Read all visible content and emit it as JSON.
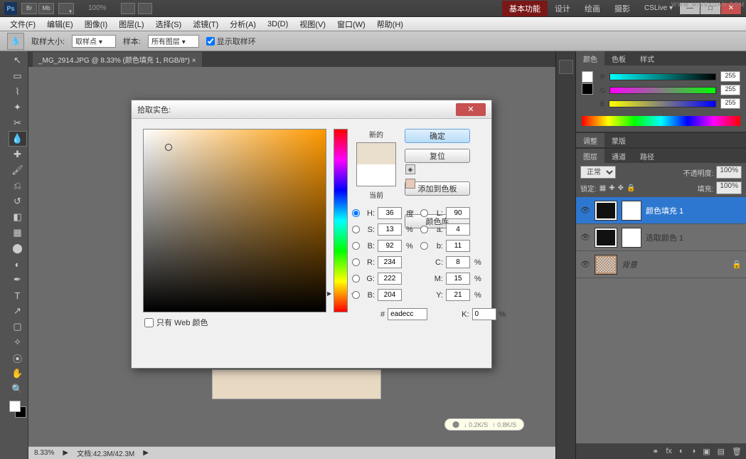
{
  "app": {
    "ps": "Ps",
    "br": "Br",
    "mb": "Mb",
    "zoom_pct": "100%"
  },
  "workspace": {
    "active": "基本功能",
    "tabs": [
      "基本功能",
      "设计",
      "绘画",
      "摄影"
    ]
  },
  "cslive": "CSLive ▾",
  "watermark": "WWW.MISSYUAN.COM",
  "menu": [
    "文件(F)",
    "编辑(E)",
    "图像(I)",
    "图层(L)",
    "选择(S)",
    "滤镜(T)",
    "分析(A)",
    "3D(D)",
    "视图(V)",
    "窗口(W)",
    "帮助(H)"
  ],
  "options": {
    "sample_size_label": "取样大小:",
    "sample_size_value": "取样点",
    "sample_label": "样本:",
    "sample_value": "所有图层",
    "show_ring": "显示取样环"
  },
  "doc": {
    "tab": "_MG_2914.JPG @ 8.33% (颜色填充 1, RGB/8*) ×"
  },
  "status": {
    "zoom": "8.33%",
    "doc": "文档:42.3M/42.3M",
    "dl": "↓ 0.2K/S",
    "ul": "↑ 0.8K/S"
  },
  "color_panel": {
    "tabs": [
      "颜色",
      "色板",
      "样式"
    ],
    "r": "255",
    "g": "255",
    "b": "255",
    "labels": [
      "R",
      "G",
      "B"
    ]
  },
  "adjust_panel": {
    "tabs": [
      "调整",
      "蒙版"
    ]
  },
  "layers_panel": {
    "tabs": [
      "图层",
      "通道",
      "路径"
    ],
    "blend": "正常",
    "opacity_label": "不透明度:",
    "opacity": "100%",
    "lock_label": "锁定:",
    "fill_label": "填充:",
    "fill": "100%",
    "layers": [
      {
        "name": "颜色填充 1",
        "selected": true,
        "mask": true
      },
      {
        "name": "选取颜色 1",
        "selected": false,
        "mask": true
      },
      {
        "name": "背景",
        "selected": false,
        "bg": true,
        "italic": true
      }
    ]
  },
  "dialog": {
    "title": "拾取实色:",
    "new": "新的",
    "current": "当前",
    "ok": "确定",
    "reset": "复位",
    "add": "添加到色板",
    "lib": "颜色库",
    "web_only": "只有 Web 颜色",
    "H": "36",
    "H_unit": "度",
    "S": "13",
    "B": "92",
    "L": "90",
    "a": "4",
    "b2": "11",
    "R": "234",
    "G": "222",
    "Bl": "204",
    "C": "8",
    "M": "15",
    "Y": "21",
    "K": "0",
    "pct": "%",
    "labels": {
      "H": "H:",
      "S": "S:",
      "B": "B:",
      "L": "L:",
      "a": "a:",
      "b": "b:",
      "R": "R:",
      "G": "G:",
      "Bl": "B:",
      "C": "C:",
      "M": "M:",
      "Y": "Y:",
      "K": "K:"
    },
    "hex": "eadecc",
    "hash": "#"
  }
}
